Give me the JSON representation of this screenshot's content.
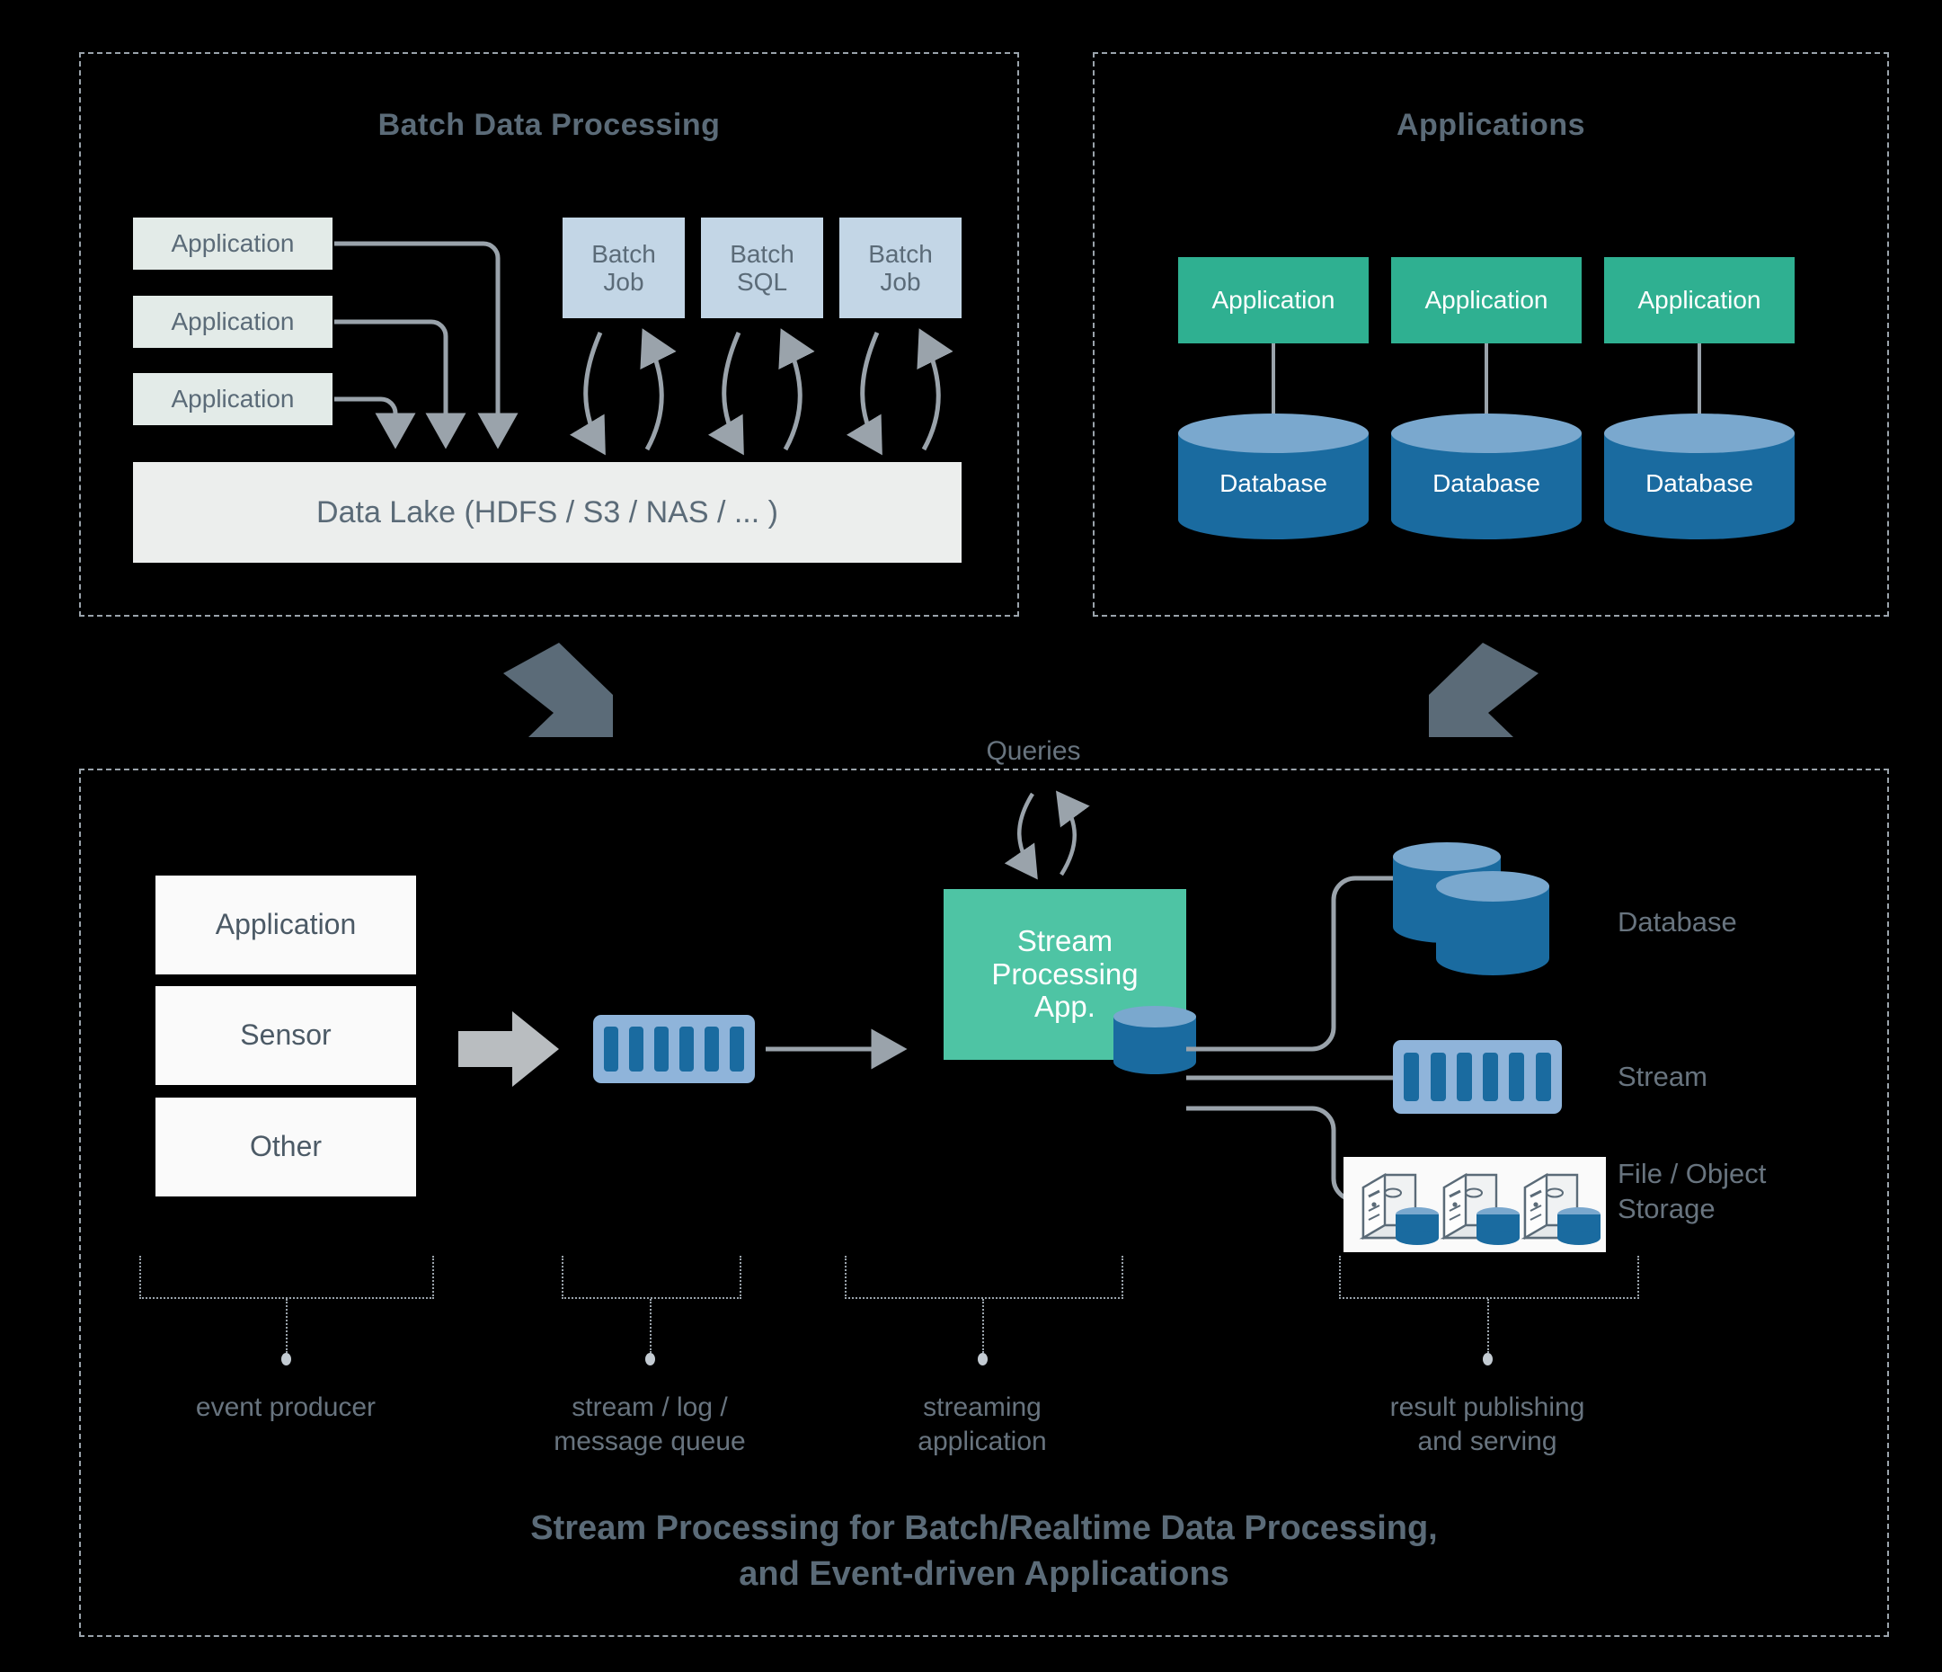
{
  "diagram": {
    "colors": {
      "background": "#000000",
      "panel_border": "#9aa3ab",
      "title_text": "#5b6b78",
      "app_pale": "#e3ebe8",
      "batch_box": "#c3d6e6",
      "app_green": "#2fb091",
      "stream_app_green": "#4ec4a4",
      "database_blue": "#1a6ba0",
      "database_top": "#7aa8ce",
      "stream_light": "#8fb4da",
      "arrow_grey": "#9aa3ab",
      "thick_arrow": "#5b6b78"
    },
    "bottom_title": [
      "Stream Processing for Batch/Realtime Data Processing,",
      "and Event-driven Applications"
    ]
  },
  "batch_panel": {
    "title": "Batch Data Processing",
    "applications": [
      "Application",
      "Application",
      "Application"
    ],
    "jobs": [
      {
        "line1": "Batch",
        "line2": "Job"
      },
      {
        "line1": "Batch",
        "line2": "SQL"
      },
      {
        "line1": "Batch",
        "line2": "Job"
      }
    ],
    "data_lake": "Data Lake (HDFS / S3 / NAS / ... )"
  },
  "applications_panel": {
    "title": "Applications",
    "columns": [
      {
        "app": "Application",
        "db": "Database"
      },
      {
        "app": "Application",
        "db": "Database"
      },
      {
        "app": "Application",
        "db": "Database"
      }
    ]
  },
  "stream_panel": {
    "producers": [
      "Application",
      "Sensor",
      "Other"
    ],
    "queries_label": "Queries",
    "processing_app": [
      "Stream",
      "Processing",
      "App."
    ],
    "sinks": [
      {
        "label": "Database"
      },
      {
        "label": "Stream"
      },
      {
        "label": "File / Object\nStorage",
        "line1": "File / Object",
        "line2": "Storage"
      }
    ],
    "stage_labels": [
      {
        "line1": "event producer",
        "line2": ""
      },
      {
        "line1": "stream / log /",
        "line2": "message queue"
      },
      {
        "line1": "streaming",
        "line2": "application"
      },
      {
        "line1": "result publishing",
        "line2": "and serving"
      }
    ]
  }
}
